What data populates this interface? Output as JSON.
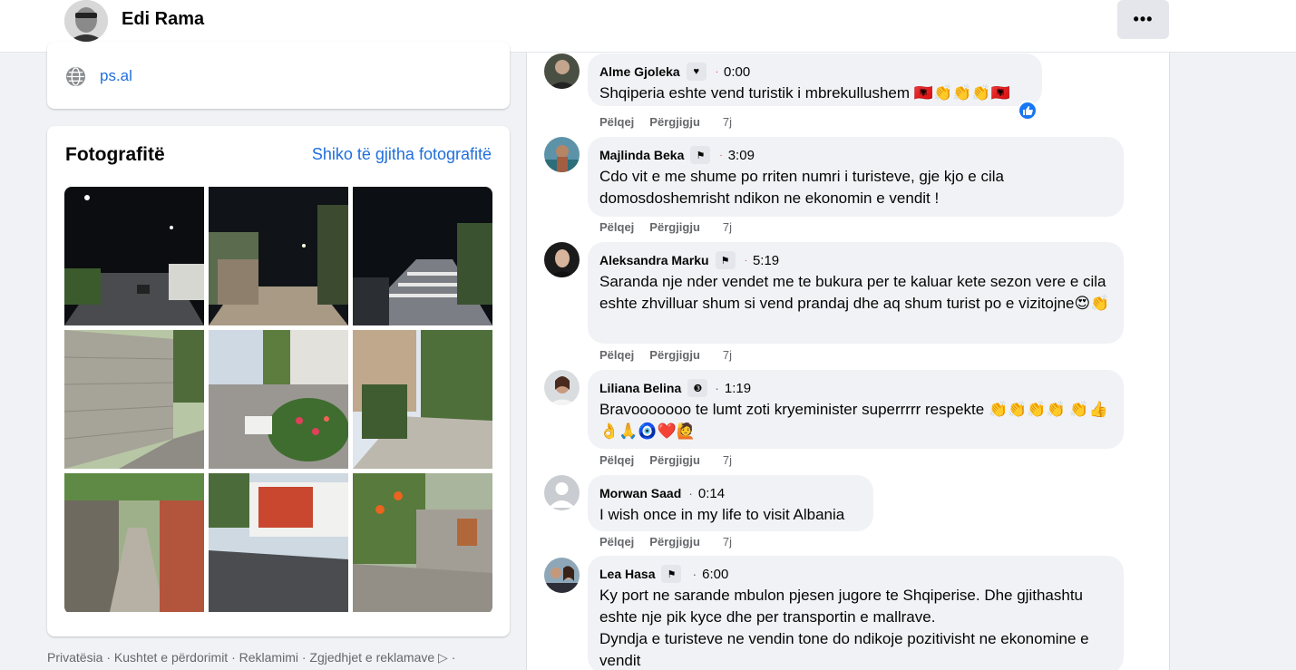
{
  "header": {
    "page_name": "Edi Rama",
    "more_label": "•••"
  },
  "intro": {
    "website": "ps.al"
  },
  "photos": {
    "title": "Fotografitë",
    "see_all": "Shiko të gjitha fotografitë"
  },
  "footer": {
    "links": "Privatësia · Kushtet e përdorimit · Reklamimi · Zgjedhjet e reklamave ▷ ·"
  },
  "comments": [
    {
      "name": "Alme Gjoleka",
      "badge": "heart-badge",
      "time": "0:00",
      "text": "Shqiperia eshte vend turistik i mbrekullushem 🇦🇱👏👏👏🇦🇱",
      "reply": "Pëlqej",
      "answer": "Përgjigju",
      "ago": "7j"
    },
    {
      "name": "Majlinda Beka",
      "badge": "flag-badge",
      "time": "3:09",
      "text": "Cdo vit e me shume po rriten numri i turisteve, gje kjo e cila domosdoshemrisht ndikon ne ekonomin e vendit !",
      "reply": "Pëlqej",
      "answer": "Përgjigju",
      "ago": "7j"
    },
    {
      "name": "Aleksandra Marku",
      "badge": "flag-badge",
      "time": "5:19",
      "text": "Saranda nje nder vendet me te bukura per te kaluar kete sezon vere e cila eshte zhvilluar shum si vend prandaj dhe aq shum turist po e vizitojne😍👏",
      "reply": "Pëlqej",
      "answer": "Përgjigju",
      "ago": "7j"
    },
    {
      "name": "Liliana Belina",
      "badge": "fan-badge",
      "time": "1:19",
      "text": "Bravooooooo te lumt zoti kryeminister superrrrr respekte 👏👏👏👏 👏👍👌🙏🧿❤️🙋",
      "reply": "Pëlqej",
      "answer": "Përgjigju",
      "ago": "7j"
    },
    {
      "name": "Morwan Saad",
      "badge": "",
      "time": "0:14",
      "text": "I wish once in my life to visit Albania",
      "reply": "Pëlqej",
      "answer": "Përgjigju",
      "ago": "7j"
    },
    {
      "name": "Lea Hasa",
      "badge": "flag-badge",
      "time": "6:00",
      "text": "Ky port ne sarande mbulon pjesen jugore te Shqiperise. Dhe gjithashtu eshte nje pik kyce dhe per transportin e mallrave.",
      "text2": "Dyndja e turisteve ne vendin tone do ndikoje pozitivisht ne ekonomine e vendit",
      "reply": "",
      "answer": "",
      "ago": ""
    }
  ],
  "colors": {
    "link": "#216fdb",
    "like": "#1877f2",
    "bubble": "#f0f2f5"
  }
}
